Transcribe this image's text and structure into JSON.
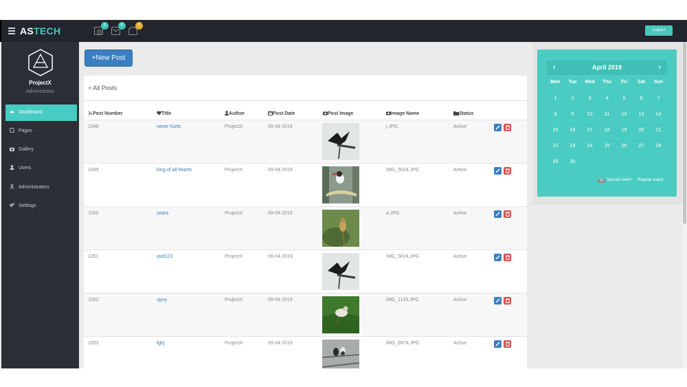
{
  "app": {
    "brand_prefix": "AS",
    "brand_suffix": "TECH"
  },
  "topbar": {
    "badges": [
      {
        "icon": "list-icon",
        "count": "0"
      },
      {
        "icon": "mail-icon",
        "count": "0"
      },
      {
        "icon": "bell-icon",
        "count": "0"
      }
    ],
    "logout_label": "Logout"
  },
  "sidebar": {
    "project": "ProjectX",
    "role": "Administrator",
    "items": [
      {
        "label": "Dashboard",
        "icon": "dashboard-icon",
        "active": true
      },
      {
        "label": "Pages",
        "icon": "file-icon"
      },
      {
        "label": "Gallery",
        "icon": "camera-icon"
      },
      {
        "label": "Users",
        "icon": "user-icon"
      },
      {
        "label": "Administrators",
        "icon": "admin-icon"
      },
      {
        "label": "Settings",
        "icon": "gears-icon"
      }
    ]
  },
  "main": {
    "new_post_label": "+New Post",
    "breadcrumb": "> All Posts",
    "columns": [
      "Post Number",
      "Title",
      "Author",
      "Post Date",
      "Post Image",
      "Image Name",
      "Status"
    ],
    "rows": [
      {
        "number": "1048",
        "title": "never hurts",
        "author": "ProjectX",
        "date": "09-04-2019",
        "image_name": "j.JPG",
        "status": "Active",
        "thumb": "stork"
      },
      {
        "number": "1049",
        "title": "king of all hearts",
        "author": "ProjectX",
        "date": "09-04-2019",
        "image_name": "IMG_5024.JPG",
        "status": "Active",
        "thumb": "kingfisher"
      },
      {
        "number": "1050",
        "title": "soars",
        "author": "ProjectX",
        "date": "09-04-2019",
        "image_name": "a.JPG",
        "status": "Active",
        "thumb": "sparrow"
      },
      {
        "number": "1051",
        "title": "asd123",
        "author": "ProjectX",
        "date": "09-04-2019",
        "image_name": "IMG_5024.JPG",
        "status": "Active",
        "thumb": "kingfisher"
      },
      {
        "number": "1052",
        "title": "sjyvy",
        "author": "ProjectX",
        "date": "09-04-2019",
        "image_name": "IMG_1193.JPG",
        "status": "Active",
        "thumb": "grass"
      },
      {
        "number": "1053",
        "title": "fghj",
        "author": "ProjectX",
        "date": "09-04-2019",
        "image_name": "IMG_6974.JPG",
        "status": "Active",
        "thumb": "wire"
      }
    ]
  },
  "calendar": {
    "title": "April 2019",
    "prev": "‹",
    "next": "›",
    "weekdays": [
      "Mon",
      "Tue",
      "Wed",
      "Thu",
      "Fri",
      "Sat",
      "Sun"
    ],
    "weeks": [
      [
        "1",
        "2",
        "3",
        "4",
        "5",
        "6",
        "7"
      ],
      [
        "8",
        "9",
        "10",
        "11",
        "12",
        "13",
        "14"
      ],
      [
        "15",
        "16",
        "17",
        "18",
        "19",
        "20",
        "21"
      ],
      [
        "22",
        "23",
        "24",
        "25",
        "26",
        "27",
        "28"
      ],
      [
        "29",
        "30",
        "",
        "",
        "",
        "",
        ""
      ]
    ],
    "legend_special": "Special event",
    "legend_regular": "Regular event",
    "legend_badge": "00"
  }
}
